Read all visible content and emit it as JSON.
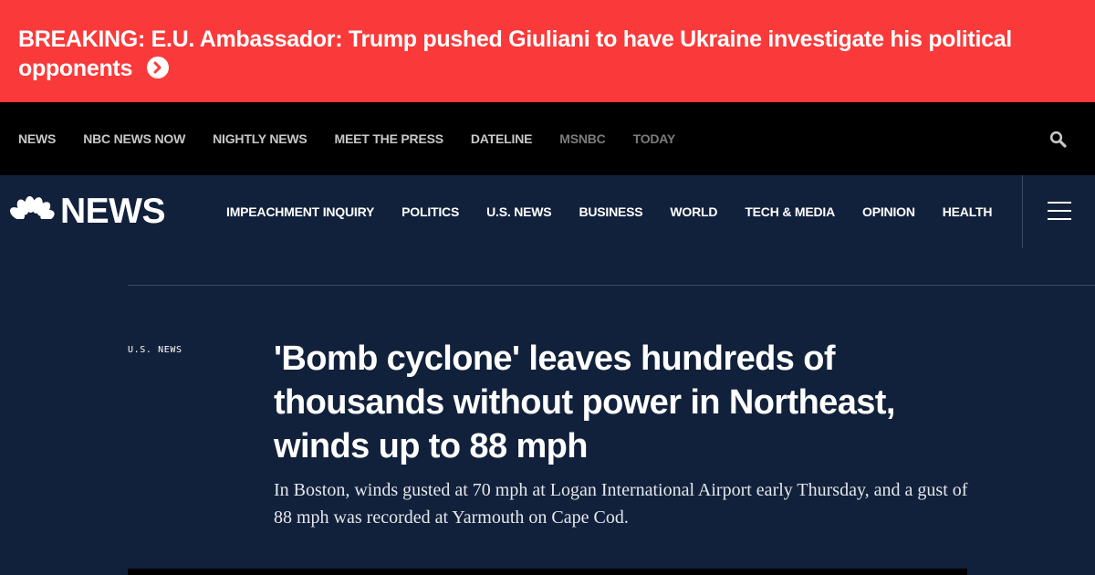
{
  "breaking": {
    "text": "BREAKING: E.U. Ambassador: Trump pushed Giuliani to have Ukraine investigate his political opponents",
    "arrow_icon": "chevron-right-circle-icon"
  },
  "top_nav": {
    "items": [
      "NEWS",
      "NBC NEWS NOW",
      "NIGHTLY NEWS",
      "MEET THE PRESS",
      "DATELINE",
      "MSNBC",
      "TODAY"
    ],
    "search_icon": "search-icon"
  },
  "main_nav": {
    "logo_text": "NEWS",
    "logo_icon": "peacock-icon",
    "items": [
      "IMPEACHMENT INQUIRY",
      "POLITICS",
      "U.S. NEWS",
      "BUSINESS",
      "WORLD",
      "TECH & MEDIA",
      "OPINION",
      "HEALTH"
    ],
    "menu_icon": "hamburger-menu-icon"
  },
  "article": {
    "section": "U.S. NEWS",
    "headline": "'Bomb cyclone' leaves hundreds of thousands without power in Northeast, winds up to 88 mph",
    "dek": "In Boston, winds gusted at 70 mph at Logan International Airport early Thursday, and a gust of 88 mph was recorded at Yarmouth on Cape Cod."
  },
  "colors": {
    "breaking_bg": "#fa3a3a",
    "top_nav_bg": "#000000",
    "page_bg": "#12213b"
  }
}
